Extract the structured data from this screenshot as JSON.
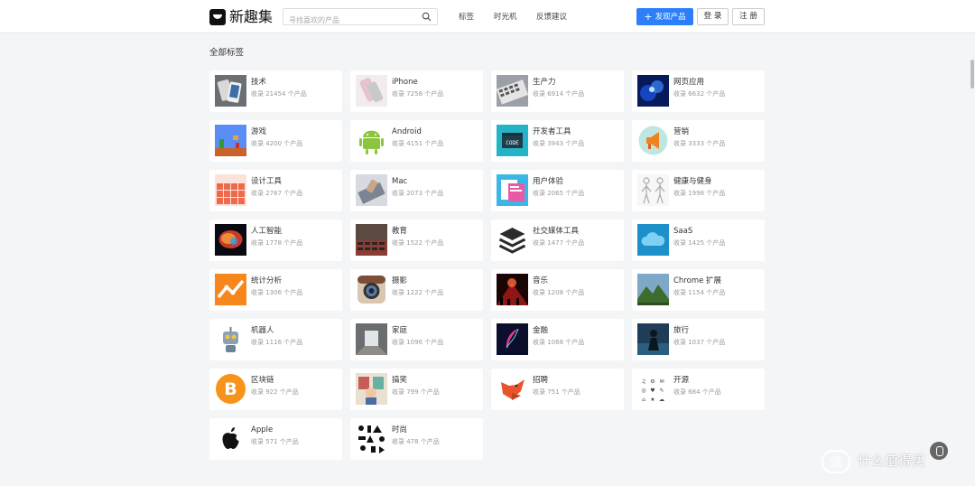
{
  "header": {
    "brand": "新趣集",
    "search_placeholder": "寻找喜欢的产品",
    "nav": [
      "标签",
      "时光机",
      "反馈建议"
    ],
    "publish_label": "发现产品",
    "login_label": "登 录",
    "signup_label": "注 册"
  },
  "page": {
    "section_title": "全部标签"
  },
  "tags": [
    {
      "name": "技术",
      "count": "收录 21454 个产品",
      "icon": "phones-photo"
    },
    {
      "name": "iPhone",
      "count": "收录 7258 个产品",
      "icon": "iphone-photo"
    },
    {
      "name": "生产力",
      "count": "收录 6914 个产品",
      "icon": "keyboard-photo"
    },
    {
      "name": "网页应用",
      "count": "收录 6632 个产品",
      "icon": "blue-particles-photo"
    },
    {
      "name": "游戏",
      "count": "收录 4200 个产品",
      "icon": "pixel-game-photo"
    },
    {
      "name": "Android",
      "count": "收录 4151 个产品",
      "icon": "android-robot-icon"
    },
    {
      "name": "开发者工具",
      "count": "收录 3943 个产品",
      "icon": "code-icon"
    },
    {
      "name": "营销",
      "count": "收录 3333 个产品",
      "icon": "megaphone-icon"
    },
    {
      "name": "设计工具",
      "count": "收录 2767 个产品",
      "icon": "color-grid-photo"
    },
    {
      "name": "Mac",
      "count": "收录 2073 个产品",
      "icon": "laptop-photo"
    },
    {
      "name": "用户体验",
      "count": "收录 2065 个产品",
      "icon": "ui-screens-photo"
    },
    {
      "name": "健康与健身",
      "count": "收录 1998 个产品",
      "icon": "anatomy-figures-photo"
    },
    {
      "name": "人工智能",
      "count": "收录 1778 个产品",
      "icon": "brain-photo"
    },
    {
      "name": "教育",
      "count": "收录 1522 个产品",
      "icon": "lecture-hall-photo"
    },
    {
      "name": "社交媒体工具",
      "count": "收录 1477 个产品",
      "icon": "layers-icon"
    },
    {
      "name": "SaaS",
      "count": "收录 1425 个产品",
      "icon": "cloud-icon"
    },
    {
      "name": "统计分析",
      "count": "收录 1306 个产品",
      "icon": "analytics-chart-icon"
    },
    {
      "name": "摄影",
      "count": "收录 1222 个产品",
      "icon": "instagram-camera-icon"
    },
    {
      "name": "音乐",
      "count": "收录 1208 个产品",
      "icon": "concert-photo"
    },
    {
      "name": "Chrome 扩展",
      "count": "收录 1154 个产品",
      "icon": "mountain-photo"
    },
    {
      "name": "机器人",
      "count": "收录 1116 个产品",
      "icon": "robot-icon"
    },
    {
      "name": "家庭",
      "count": "收录 1096 个产品",
      "icon": "house-interior-photo"
    },
    {
      "name": "金融",
      "count": "收录 1068 个产品",
      "icon": "feather-icon"
    },
    {
      "name": "旅行",
      "count": "收录 1037 个产品",
      "icon": "traveler-photo"
    },
    {
      "name": "区块链",
      "count": "收录 922 个产品",
      "icon": "bitcoin-icon"
    },
    {
      "name": "搞笑",
      "count": "收录 799 个产品",
      "icon": "cartoon-photo"
    },
    {
      "name": "招聘",
      "count": "收录 751 个产品",
      "icon": "fox-icon"
    },
    {
      "name": "开源",
      "count": "收录 684 个产品",
      "icon": "symbols-icon"
    },
    {
      "name": "Apple",
      "count": "收录 571 个产品",
      "icon": "apple-logo-icon"
    },
    {
      "name": "时尚",
      "count": "收录 478 个产品",
      "icon": "fashion-pattern-photo"
    }
  ],
  "colors": {
    "primary": "#2d7ff9",
    "page_bg": "#f4f5f7"
  },
  "watermark": "值 什么值得买"
}
